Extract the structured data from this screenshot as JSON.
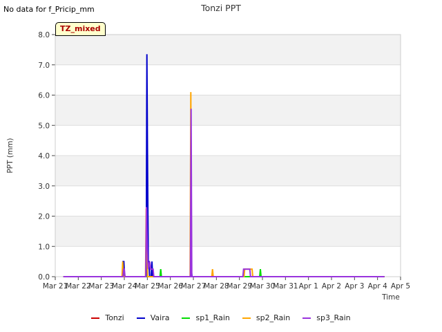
{
  "header": {
    "no_data_text": "No data for f_Pricip_mm",
    "title": "Tonzi PPT",
    "badge": "TZ_mixed"
  },
  "chart_data": {
    "type": "line",
    "title": "Tonzi PPT",
    "xlabel": "Time",
    "ylabel": "PPT (mm)",
    "ylim": [
      0,
      8
    ],
    "xlim": [
      0,
      15
    ],
    "y_ticks": [
      "0.0",
      "1.0",
      "2.0",
      "3.0",
      "4.0",
      "5.0",
      "6.0",
      "7.0",
      "8.0"
    ],
    "x_ticks": [
      "Mar 21",
      "Mar 22",
      "Mar 23",
      "Mar 24",
      "Mar 25",
      "Mar 26",
      "Mar 27",
      "Mar 28",
      "Mar 29",
      "Mar 30",
      "Mar 31",
      "Apr 1",
      "Apr 2",
      "Apr 3",
      "Apr 4",
      "Apr 5"
    ],
    "x_units": "days since Mar 21 00:00",
    "grid": true,
    "legend_position": "bottom",
    "series": [
      {
        "name": "Tonzi",
        "color": "#cc0000",
        "points": [
          [
            0.35,
            0
          ],
          [
            14.3,
            0
          ]
        ]
      },
      {
        "name": "Vaira",
        "color": "#0000cc",
        "points": [
          [
            0.35,
            0
          ],
          [
            2.92,
            0
          ],
          [
            2.95,
            0.5
          ],
          [
            2.98,
            0.5
          ],
          [
            3.01,
            0
          ],
          [
            3.95,
            0
          ],
          [
            3.98,
            7.35
          ],
          [
            4.01,
            3.5
          ],
          [
            4.04,
            0.5
          ],
          [
            4.07,
            0.5
          ],
          [
            4.1,
            0
          ],
          [
            4.17,
            0
          ],
          [
            4.2,
            0.5
          ],
          [
            4.23,
            0
          ],
          [
            5.88,
            0
          ],
          [
            5.91,
            0.25
          ],
          [
            5.94,
            0
          ],
          [
            14.3,
            0
          ]
        ]
      },
      {
        "name": "sp1_Rain",
        "color": "#00dd00",
        "points": [
          [
            0.35,
            0
          ],
          [
            4.55,
            0
          ],
          [
            4.58,
            0.25
          ],
          [
            4.61,
            0
          ],
          [
            8.88,
            0
          ],
          [
            8.91,
            0.25
          ],
          [
            8.94,
            0
          ],
          [
            14.3,
            0
          ]
        ]
      },
      {
        "name": "sp2_Rain",
        "color": "#ffa500",
        "points": [
          [
            0.35,
            0
          ],
          [
            2.9,
            0
          ],
          [
            2.93,
            0.5
          ],
          [
            2.96,
            0
          ],
          [
            3.92,
            0
          ],
          [
            3.95,
            2.25
          ],
          [
            3.98,
            1.0
          ],
          [
            4.01,
            0
          ],
          [
            5.86,
            0
          ],
          [
            5.89,
            6.1
          ],
          [
            5.92,
            0
          ],
          [
            6.8,
            0
          ],
          [
            6.83,
            0.25
          ],
          [
            6.86,
            0
          ],
          [
            8.2,
            0
          ],
          [
            8.23,
            0.25
          ],
          [
            8.55,
            0.25
          ],
          [
            8.58,
            0
          ],
          [
            14.3,
            0
          ]
        ]
      },
      {
        "name": "sp3_Rain",
        "color": "#9933dd",
        "points": [
          [
            0.35,
            0
          ],
          [
            2.94,
            0
          ],
          [
            2.97,
            0.25
          ],
          [
            3.0,
            0.25
          ],
          [
            3.03,
            0
          ],
          [
            3.93,
            0
          ],
          [
            3.96,
            2.3
          ],
          [
            3.99,
            1.25
          ],
          [
            4.02,
            0.5
          ],
          [
            4.05,
            0.25
          ],
          [
            4.1,
            0.5
          ],
          [
            4.15,
            0.25
          ],
          [
            4.25,
            0.25
          ],
          [
            4.28,
            0
          ],
          [
            5.87,
            0
          ],
          [
            5.9,
            5.55
          ],
          [
            5.93,
            0
          ],
          [
            8.15,
            0
          ],
          [
            8.18,
            0.25
          ],
          [
            8.45,
            0.25
          ],
          [
            8.48,
            0
          ],
          [
            14.3,
            0
          ]
        ]
      }
    ]
  }
}
